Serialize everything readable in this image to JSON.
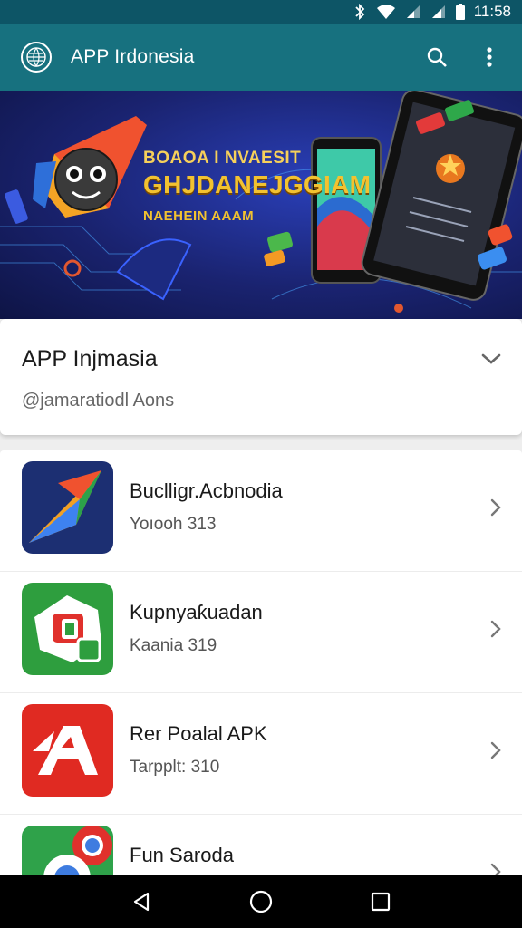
{
  "status_bar": {
    "time": "11:58",
    "icons": [
      "bluetooth-icon",
      "wifi-icon",
      "signal-icon",
      "signal-icon",
      "battery-icon"
    ]
  },
  "app_bar": {
    "title": "APP Irdonesia",
    "logo_icon": "globe-icon",
    "actions": [
      "search-icon",
      "more-vert-icon"
    ]
  },
  "hero": {
    "title": "BOAOA I NVAESIT",
    "headline": "GHJDANEJGGIAM",
    "subtitle": "NAEHEIN AAAM",
    "colors": {
      "background": "#1a2370",
      "accent": "#f2c230"
    }
  },
  "search_card": {
    "title": "APP Injmasia",
    "subtitle": "@jamaratiodl Aons",
    "chevron_icon": "chevron-down-icon"
  },
  "apps": [
    {
      "name": "Buclligr.Acbnodia",
      "meta": "Yoıooh  313",
      "icon": "paper-plane-logo-icon",
      "bg": "#1c2f72"
    },
    {
      "name": "Kupnyaƙuadan",
      "meta": "Kaania 319",
      "icon": "green-app-logo-icon",
      "bg": "#2e9e3e"
    },
    {
      "name": "Rer Poalal APK",
      "meta": "Tarpplt: 310",
      "icon": "red-a-logo-icon",
      "bg": "#e02a22"
    },
    {
      "name": "Fun Saroda",
      "meta": "",
      "icon": "chrome-logo-icon",
      "bg": "#2fa24a"
    }
  ],
  "nav_bar": {
    "buttons": [
      "back-icon",
      "home-icon",
      "recents-icon"
    ]
  }
}
